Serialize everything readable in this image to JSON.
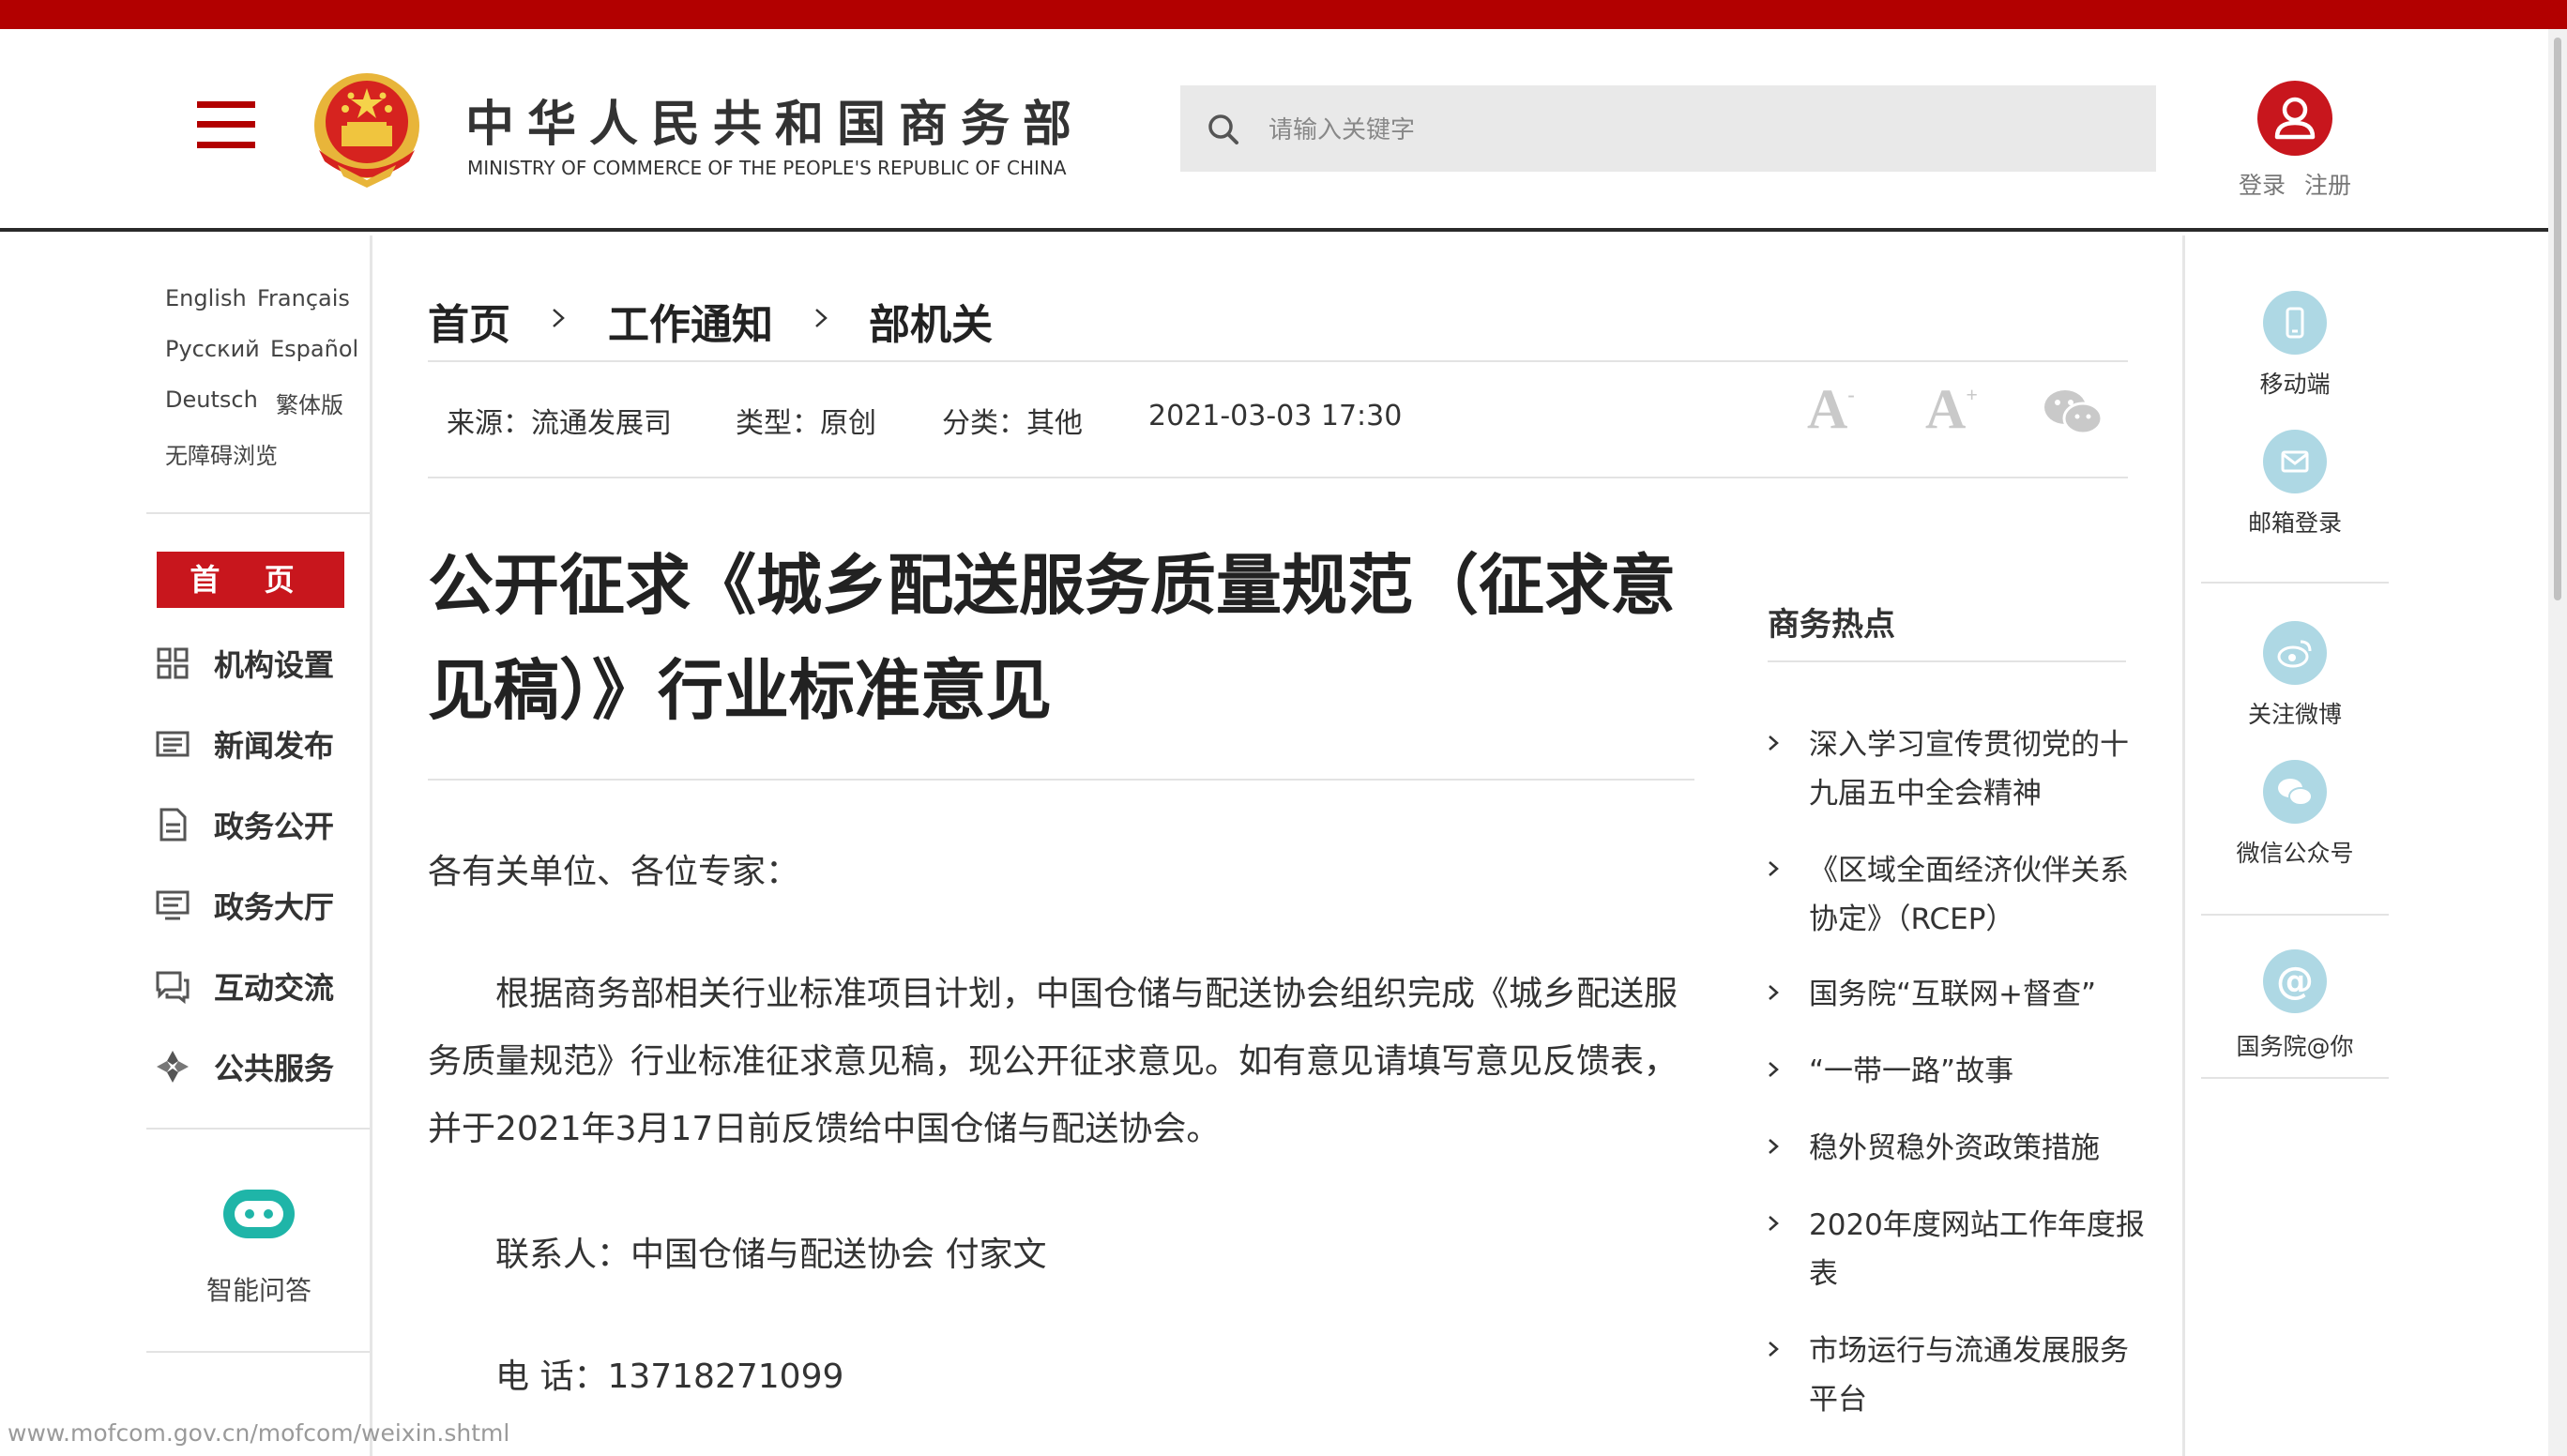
{
  "header": {
    "title_cn": "中华人民共和国商务部",
    "title_en": "MINISTRY OF COMMERCE OF THE PEOPLE'S REPUBLIC OF CHINA",
    "search_placeholder": "请输入关键字",
    "login": "登录",
    "register": "注册"
  },
  "languages": [
    "English",
    "Français",
    "Русский",
    "Español",
    "Deutsch",
    "繁体版",
    "无障碍浏览"
  ],
  "left_nav": {
    "home": "首 页",
    "items": [
      "机构设置",
      "新闻发布",
      "政务公开",
      "政务大厅",
      "互动交流",
      "公共服务"
    ],
    "assistant": "智能问答"
  },
  "breadcrumb": [
    "首页",
    "工作通知",
    "部机关"
  ],
  "meta": {
    "source": "来源：流通发展司",
    "type": "类型：原创",
    "category": "分类：其他",
    "date": "2021-03-03 17:30"
  },
  "tools": {
    "font_decrease": "A",
    "font_increase": "A"
  },
  "article": {
    "title": "公开征求《城乡配送服务质量规范（征求意见稿）》行业标准意见",
    "greeting": "各有关单位、各位专家：",
    "body": "根据商务部相关行业标准项目计划，中国仓储与配送协会组织完成《城乡配送服务质量规范》行业标准征求意见稿，现公开征求意见。如有意见请填写意见反馈表，并于2021年3月17日前反馈给中国仓储与配送协会。",
    "contact": "联系人：中国仓储与配送协会 付家文",
    "phone": "电 话：13718271099"
  },
  "hot": {
    "heading": "商务热点",
    "items": [
      "深入学习宣传贯彻党的十九届五中全会精神",
      "《区域全面经济伙伴关系协定》（RCEP）",
      "国务院“互联网+督查”",
      "“一带一路”故事",
      "稳外贸稳外资政策措施",
      "2020年度网站工作年度报表",
      "市场运行与流通发展服务平台"
    ]
  },
  "right_links": [
    "移动端",
    "邮箱登录",
    "关注微博",
    "微信公众号",
    "国务院@你"
  ],
  "status_url": "www.mofcom.gov.cn/mofcom/weixin.shtml",
  "colors": {
    "brand_red": "#b20000",
    "accent_red": "#c8161d",
    "icon_blue": "#aed8e4"
  }
}
